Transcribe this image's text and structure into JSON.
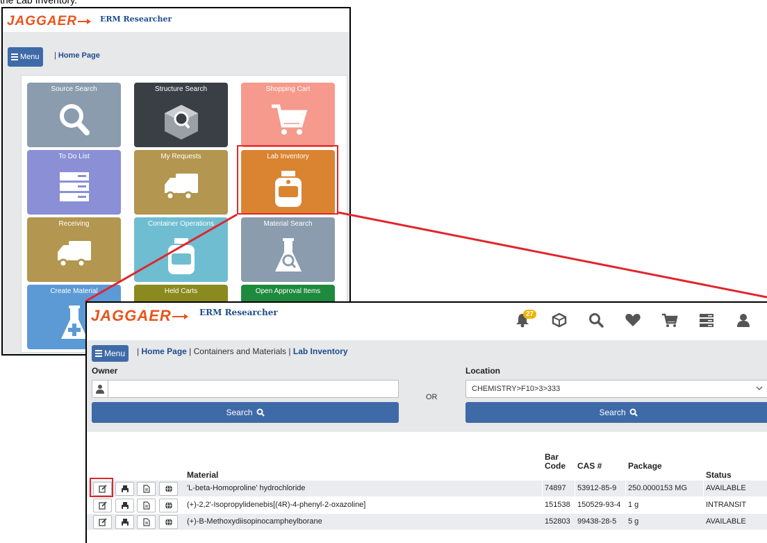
{
  "page_caption": "the Lab Inventory.",
  "brand": {
    "logo_text": "JAGGAER",
    "app_name": "ERM Researcher",
    "accent_color": "#e8541b",
    "primary_color": "#3f6aa8",
    "highlight_color": "#e0262b"
  },
  "dashboard": {
    "menu_label": "Menu",
    "breadcrumb": [
      "Home Page"
    ],
    "tiles": [
      {
        "label": "Source Search",
        "icon": "magnifier-icon",
        "color": "#8a9cae"
      },
      {
        "label": "Structure Search",
        "icon": "structure-cube-icon",
        "color": "#3a3f46"
      },
      {
        "label": "Shopping Cart",
        "icon": "cart-icon",
        "color": "#f59a8c"
      },
      {
        "label": "To Do List",
        "icon": "todo-list-icon",
        "color": "#8a8fd6"
      },
      {
        "label": "My Requests",
        "icon": "truck-icon",
        "color": "#b3964f"
      },
      {
        "label": "Lab Inventory",
        "icon": "bottle-icon",
        "color": "#da8331"
      },
      {
        "label": "Receiving",
        "icon": "truck-icon",
        "color": "#b3964f"
      },
      {
        "label": "Container Operations",
        "icon": "bottle-icon",
        "color": "#6fbdd1"
      },
      {
        "label": "Material Search",
        "icon": "flask-search-icon",
        "color": "#8a9cae"
      },
      {
        "label": "Create Material",
        "icon": "flask-plus-icon",
        "color": "#5c9ad6"
      },
      {
        "label": "Held Carts",
        "icon": "cart-icon",
        "color": "#8a8a1e"
      },
      {
        "label": "Open Approval Items",
        "icon": "check-icon",
        "color": "#1e8a3e"
      }
    ]
  },
  "inventory": {
    "notification_count": "27",
    "header_icons": [
      "bell-icon",
      "cube-icon",
      "search-icon",
      "heart-icon",
      "cart-icon",
      "list-icon",
      "user-icon"
    ],
    "menu_label": "Menu",
    "breadcrumb": {
      "home": "Home Page",
      "middle": "Containers and Materials",
      "current": "Lab Inventory"
    },
    "owner_label": "Owner",
    "owner_value": "",
    "or_label": "OR",
    "location_label": "Location",
    "location_value": "CHEMISTRY>F10>3>333",
    "search_label": "Search",
    "columns": {
      "material": "Material",
      "barcode_line1": "Bar",
      "barcode_line2": "Code",
      "cas": "CAS #",
      "package": "Package",
      "status": "Status"
    },
    "rows": [
      {
        "material": "'L-beta-Homoproline' hydrochloride",
        "barcode": "74897",
        "cas": "53912-85-9",
        "package": "250.0000153 MG",
        "status": "AVAILABLE"
      },
      {
        "material": "(+)-2,2'-Isopropylidenebis[(4R)-4-phenyl-2-oxazoline]",
        "barcode": "151538",
        "cas": "150529-93-4",
        "package": "1 g",
        "status": "INTRANSIT"
      },
      {
        "material": "(+)-B-Methoxydiisopinocampheylborane",
        "barcode": "152803",
        "cas": "99438-28-5",
        "package": "5 g",
        "status": "AVAILABLE"
      }
    ],
    "row_actions": [
      "edit-icon",
      "print-icon",
      "document-icon",
      "globe-icon"
    ]
  }
}
